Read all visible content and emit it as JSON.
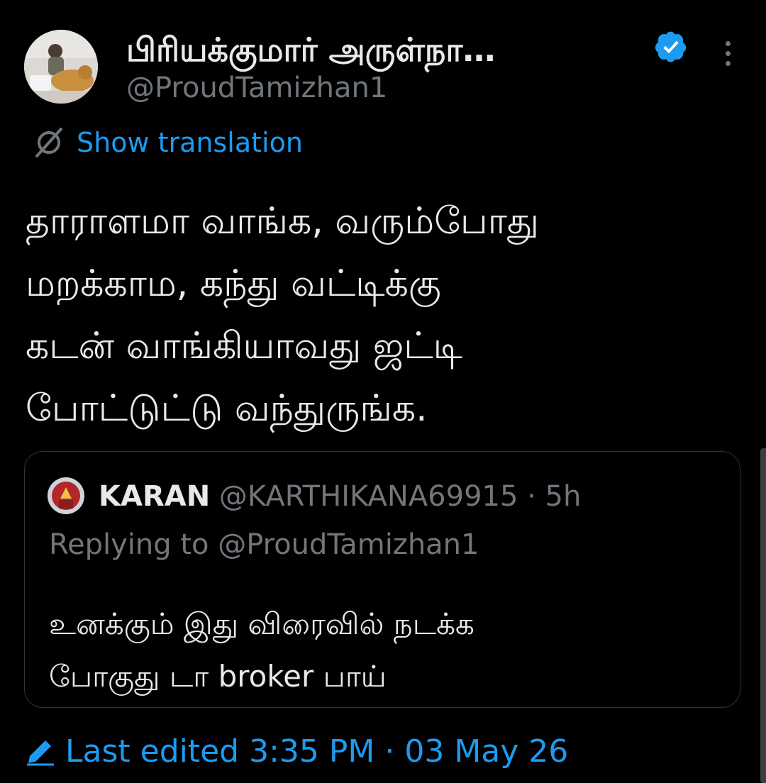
{
  "author": {
    "name": "பிரியக்குமார் அருள்நா…",
    "handle": "@ProudTamizhan1",
    "verified_color": "#1d9bf0"
  },
  "translate": {
    "label": "Show translation"
  },
  "tweet": {
    "lines": [
      "தாராளமா வாங்க, வரும்போது",
      "மறக்காம, கந்து வட்டிக்கு",
      "கடன் வாங்கியாவது ஜட்டி",
      "போட்டுட்டு வந்துருங்க."
    ]
  },
  "quote": {
    "name": "KARAN",
    "handle_time": "@KARTHIKANA69915 · 5h",
    "replying_to": "Replying to @ProudTamizhan1",
    "lines": [
      "உனக்கும் இது விரைவில் நடக்க",
      "போகுது டா broker பாய்"
    ]
  },
  "footer": {
    "edited": "Last edited 3:35 PM · 03 May 26"
  },
  "colors": {
    "accent": "#1d9bf0",
    "muted": "#71767b",
    "text": "#e7e9ea",
    "background": "#000000"
  }
}
